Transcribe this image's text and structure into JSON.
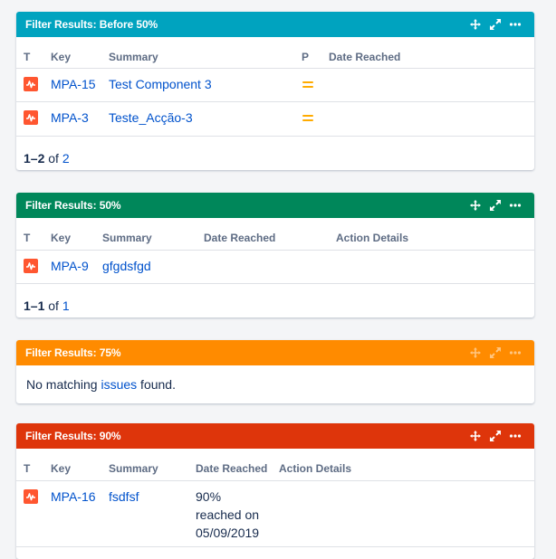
{
  "colors": {
    "blue": "#00a3bf",
    "green": "#00875a",
    "orange": "#ff8b00",
    "red": "#de350b"
  },
  "gadget1": {
    "title": "Filter Results: Before 50%",
    "columns": {
      "t": "T",
      "key": "Key",
      "summary": "Summary",
      "p": "P",
      "date": "Date Reached"
    },
    "rows": [
      {
        "key": "MPA-15",
        "summary": "Test Component 3",
        "priority": "medium"
      },
      {
        "key": "MPA-3",
        "summary": "Teste_Acção-3",
        "priority": "medium"
      }
    ],
    "pager": {
      "range": "1–2",
      "of": "of",
      "total": "2"
    }
  },
  "gadget2": {
    "title": "Filter Results: 50%",
    "columns": {
      "t": "T",
      "key": "Key",
      "summary": "Summary",
      "date": "Date Reached",
      "action": "Action Details"
    },
    "rows": [
      {
        "key": "MPA-9",
        "summary": "gfgdsfgd"
      }
    ],
    "pager": {
      "range": "1–1",
      "of": "of",
      "total": "1"
    }
  },
  "gadget3": {
    "title": "Filter Results: 75%",
    "message": {
      "before": "No matching ",
      "link": "issues",
      "after": " found."
    }
  },
  "gadget4": {
    "title": "Filter Results: 90%",
    "columns": {
      "t": "T",
      "key": "Key",
      "summary": "Summary",
      "date": "Date Reached",
      "action": "Action Details"
    },
    "rows": [
      {
        "key": "MPA-16",
        "summary": "fsdfsf",
        "date_line1": "90%",
        "date_line2": "reached on",
        "date_line3": "05/09/2019"
      }
    ]
  },
  "icons": [
    "move-icon",
    "expand-icon",
    "more-icon",
    "bug-icon",
    "priority-medium-icon"
  ]
}
